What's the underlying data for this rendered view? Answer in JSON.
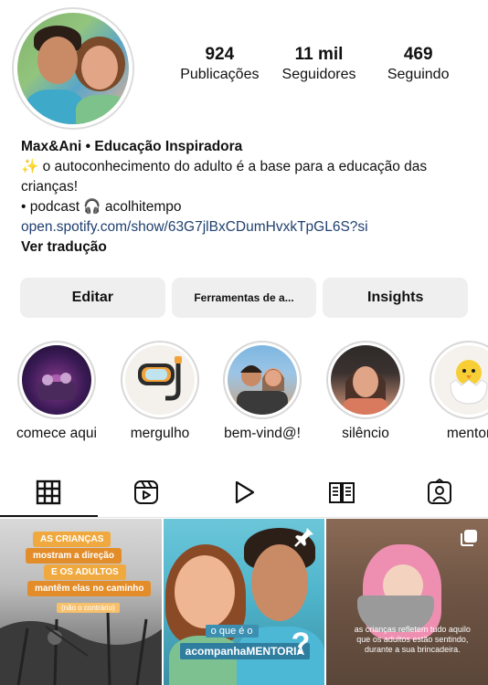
{
  "profile": {
    "stats": [
      {
        "value": "924",
        "label": "Publicações"
      },
      {
        "value": "11 mil",
        "label": "Seguidores"
      },
      {
        "value": "469",
        "label": "Seguindo"
      }
    ],
    "name": "Max&Ani • Educação Inspiradora",
    "bio_line1": "✨ o autoconhecimento do adulto é a base para a educação das crianças!",
    "bio_line2": "• podcast 🎧 acolhitempo",
    "link": "open.spotify.com/show/63G7jlBxCDumHvxkTpGL6S?si",
    "translate": "Ver tradução"
  },
  "buttons": {
    "edit": "Editar",
    "tools": "Ferramentas de a...",
    "insights": "Insights"
  },
  "highlights": [
    {
      "label": "comece aqui"
    },
    {
      "label": "mergulho"
    },
    {
      "label": "bem-vind@!"
    },
    {
      "label": "silêncio"
    },
    {
      "label": "mentor"
    }
  ],
  "tabs": [
    "grid-icon",
    "reels-icon",
    "play-icon",
    "guide-icon",
    "tagged-icon"
  ],
  "posts": {
    "post1": {
      "lines": [
        "AS CRIANÇAS",
        "mostram a direção",
        "E OS ADULTOS",
        "mantêm elas no caminho",
        "(não o contrário)"
      ]
    },
    "post2": {
      "line1": "o que é o",
      "line2": "acompanhaMENTORIA"
    },
    "post3": {
      "caption": "as crianças refletem tudo aquilo que os adultos estão sentindo, durante a sua brincadeira."
    }
  },
  "colors": {
    "button_bg": "#efefef",
    "link": "#1f3f6f",
    "tag_orange": "#f0a93f"
  }
}
